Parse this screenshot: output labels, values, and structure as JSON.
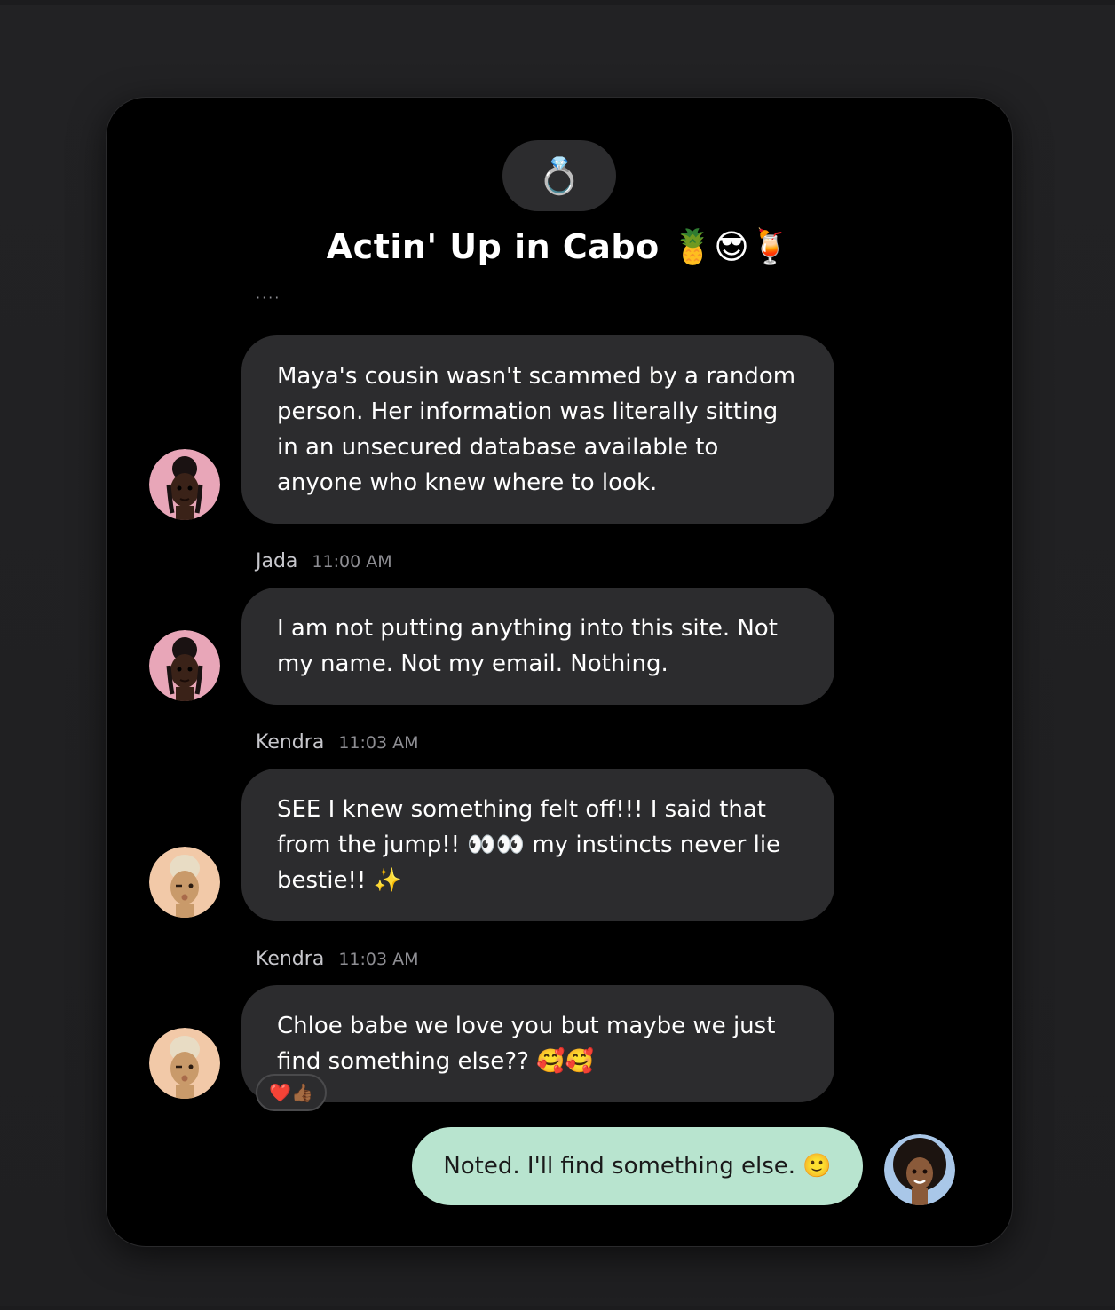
{
  "chat": {
    "group_icon": "💍",
    "title": "Actin' Up in Cabo 🍍😎🍹"
  },
  "messages": [
    {
      "sender": "",
      "time": "",
      "text": "Maya's cousin wasn't scammed by a random person. Her information was literally sitting in an unsecured database available to anyone who knew where to look.",
      "avatar": "jada-avatar"
    },
    {
      "sender": "Jada",
      "time": "11:00 AM",
      "text": "I am not putting anything into this site. Not my name. Not my email. Nothing.",
      "avatar": "jada-avatar"
    },
    {
      "sender": "Kendra",
      "time": "11:03 AM",
      "text": "SEE I knew something felt off!!! I said that from the jump!! 👀👀 my instincts never lie bestie!! ✨",
      "avatar": "kendra-avatar"
    },
    {
      "sender": "Kendra",
      "time": "11:03 AM",
      "text": "Chloe babe we love you but maybe we just find something else?? 🥰🥰",
      "avatar": "kendra-avatar",
      "reactions": "❤️👍🏾"
    }
  ],
  "outgoing": {
    "text": "Noted. I'll find something else. 🙂",
    "avatar": "my-avatar"
  },
  "colors": {
    "background": "#000000",
    "incoming_bubble": "#2c2c2e",
    "outgoing_bubble": "#b8e4cf",
    "jada_avatar_bg": "#e8a6b8",
    "kendra_avatar_bg": "#f2c9a8"
  }
}
